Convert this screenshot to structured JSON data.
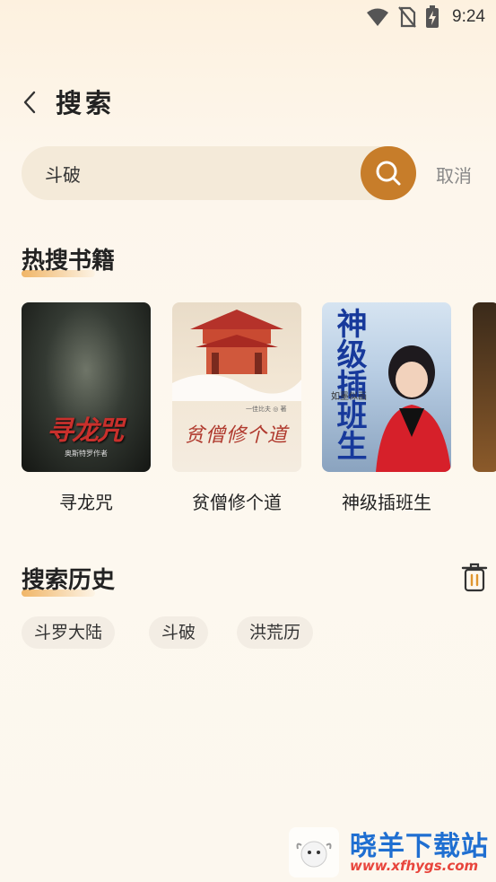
{
  "status_bar": {
    "time": "9:24",
    "icons": [
      "wifi-icon",
      "no-sim-icon",
      "battery-charging-icon"
    ]
  },
  "header": {
    "back_icon": "chevron-left-icon",
    "title": "搜索"
  },
  "search": {
    "value": "斗破",
    "search_icon": "search-icon",
    "cancel_label": "取消",
    "accent_color": "#c77d2a"
  },
  "hot_books": {
    "title": "热搜书籍",
    "items": [
      {
        "name": "寻龙咒",
        "cover_title": "寻龙咒",
        "cover_author": "奥斯特罗作者"
      },
      {
        "name": "贫僧修个道",
        "cover_title": "贫僧修个道",
        "cover_author": "一佳比夫 ◎ 著"
      },
      {
        "name": "神级插班生",
        "cover_title": "神级插班生",
        "cover_author": "如墨似画"
      }
    ]
  },
  "history": {
    "title": "搜索历史",
    "delete_icon": "trash-icon",
    "items": [
      "斗罗大陆",
      "斗破",
      "洪荒历"
    ]
  },
  "watermark": {
    "text": "晓羊下载站",
    "url": "www.xfhygs.com"
  }
}
